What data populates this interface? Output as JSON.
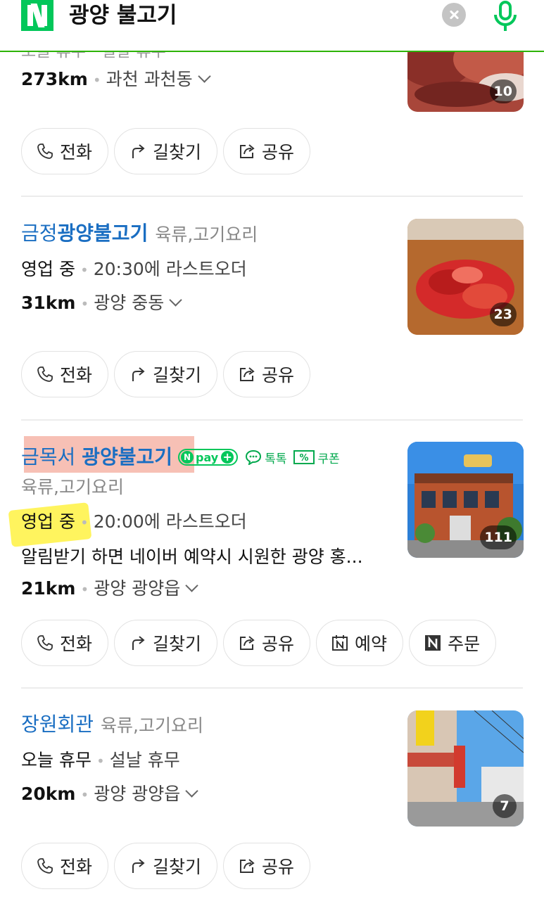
{
  "search": {
    "query": "광양 불고기"
  },
  "colors": {
    "brand": "#03c75a",
    "title_link": "#1a6ec2",
    "divider": "#ececec"
  },
  "results": [
    {
      "partial_status": "오늘 휴무 · 설날 휴무",
      "distance": "273km",
      "area": "과천 과천동",
      "photo_count": "10",
      "buttons": [
        "전화",
        "길찾기",
        "공유"
      ]
    },
    {
      "name_prefix": "금정",
      "name_highlight": "광양불고기",
      "category": "육류,고기요리",
      "status": "영업 중",
      "status_detail": "20:30에 라스트오더",
      "distance": "31km",
      "area": "광양 중동",
      "photo_count": "23",
      "buttons": [
        "전화",
        "길찾기",
        "공유"
      ]
    },
    {
      "name_prefix": "금목서 ",
      "name_highlight": "광양불고기",
      "badges": {
        "npay": "pay",
        "talk": "톡톡",
        "coupon": "쿠폰"
      },
      "category": "육류,고기요리",
      "status": "영업 중",
      "status_detail": "20:00에 라스트오더",
      "description": "알림받기 하면 네이버 예약시 시원한 광양 홍...",
      "distance": "21km",
      "area": "광양 광양읍",
      "photo_count": "111",
      "buttons": [
        "전화",
        "길찾기",
        "공유",
        "예약",
        "주문"
      ]
    },
    {
      "name": "장원회관",
      "category": "육류,고기요리",
      "status": "오늘 휴무",
      "status_detail": "설날 휴무",
      "distance": "20km",
      "area": "광양 광양읍",
      "photo_count": "7",
      "buttons": [
        "전화",
        "길찾기",
        "공유"
      ]
    }
  ]
}
